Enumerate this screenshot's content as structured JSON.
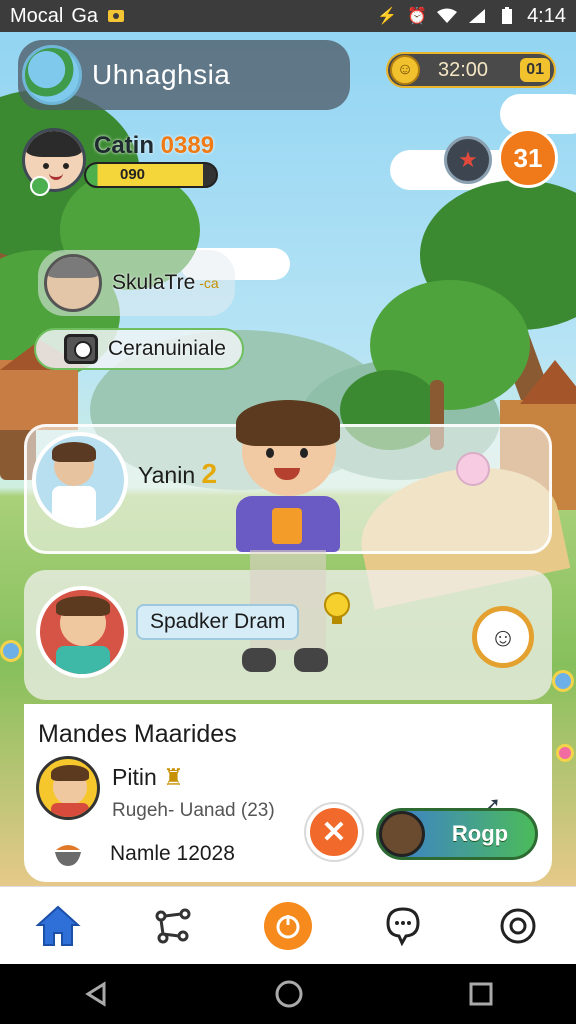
{
  "status_bar": {
    "carrier": "Mocal",
    "carrier_extra": "Ga",
    "time": "4:14"
  },
  "header": {
    "location": "Uhnaghsia",
    "timer": "32:00",
    "timer_badge": "01"
  },
  "player": {
    "name": "Catin",
    "score": "0389",
    "xp_text": "090",
    "xp_fraction": 0.9,
    "level": "31"
  },
  "quests": [
    {
      "label": "SkulaTre",
      "extra": "-ca"
    },
    {
      "label": "Ceranuiniale"
    }
  ],
  "dialog": {
    "character_label": "Yanin",
    "character_number": "2",
    "speaker_label": "Spadker Dram"
  },
  "info_card": {
    "title": "Mandes Maarides",
    "name": "Pitin",
    "subtitle": "Rugeh- Uanad (23)",
    "extra": "Namle 12028",
    "go_label": "Rogp"
  },
  "icons": {
    "target": "target-icon",
    "mask": "mask-icon",
    "close": "close-icon",
    "bulb": "lightbulb-icon"
  },
  "colors": {
    "accent_orange": "#f07a1a",
    "go_green": "#4bbb5a",
    "go_blue": "#3c7bd6",
    "nav_blue": "#2f6fd8"
  }
}
